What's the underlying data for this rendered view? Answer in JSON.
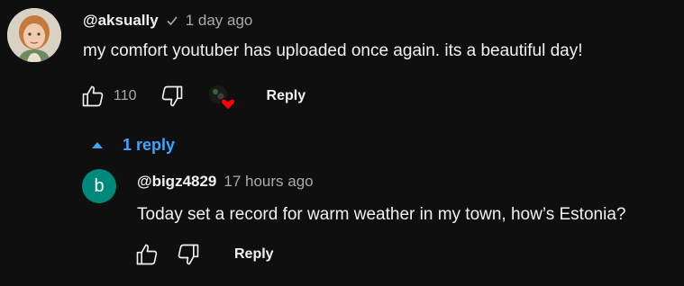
{
  "comment": {
    "handle": "@aksually",
    "verified_icon": "checkmark-icon",
    "time": "1 day ago",
    "text": "my comfort youtuber has uploaded once again. its a beautiful day!",
    "like_count": "110",
    "reply_label": "Reply",
    "creator_heart_icon": "red-heart-icon"
  },
  "replies_toggle": {
    "icon": "caret-up-icon",
    "label": "1 reply",
    "color": "#3ea6ff"
  },
  "reply": {
    "avatar_letter": "b",
    "avatar_color": "#00897b",
    "handle": "@bigz4829",
    "time": "17 hours ago",
    "text": "Today set a record for warm weather in my town, how’s Estonia?",
    "reply_label": "Reply"
  }
}
